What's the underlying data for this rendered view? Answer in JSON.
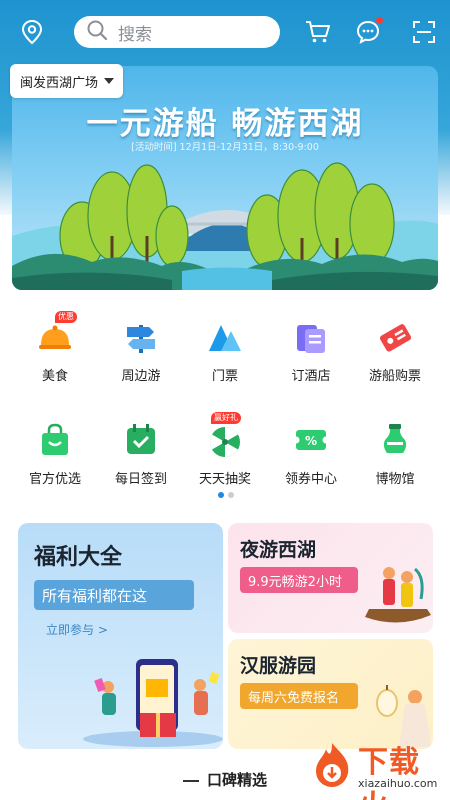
{
  "header": {
    "search_placeholder": "搜索",
    "location": "闽发西湖广场",
    "icons": [
      "location-pin-icon",
      "search-icon",
      "cart-icon",
      "message-icon",
      "scan-icon"
    ]
  },
  "banner": {
    "title": "一元游船  畅游西湖",
    "subtitle": "[活动时间] 12月1日-12月31日，8:30-9:00"
  },
  "grid": {
    "row1": [
      {
        "label": "美食",
        "icon": "food-cloche-icon",
        "tag": "优惠"
      },
      {
        "label": "周边游",
        "icon": "signpost-icon",
        "tag": ""
      },
      {
        "label": "门票",
        "icon": "mountain-icon",
        "tag": ""
      },
      {
        "label": "订酒店",
        "icon": "hotel-cards-icon",
        "tag": ""
      },
      {
        "label": "游船购票",
        "icon": "ticket-icon",
        "tag": ""
      }
    ],
    "row2": [
      {
        "label": "官方优选",
        "icon": "shopping-bag-icon",
        "tag": ""
      },
      {
        "label": "每日签到",
        "icon": "calendar-check-icon",
        "tag": ""
      },
      {
        "label": "天天抽奖",
        "icon": "lottery-wheel-icon",
        "tag": "赢好礼"
      },
      {
        "label": "领券中心",
        "icon": "coupon-icon",
        "tag": ""
      },
      {
        "label": "博物馆",
        "icon": "vase-icon",
        "tag": ""
      }
    ],
    "pager": {
      "active": 1,
      "total": 2
    }
  },
  "cards": {
    "welfare": {
      "title": "福利大全",
      "pill": "所有福利都在这",
      "link": "立即参与 >"
    },
    "night": {
      "title": "夜游西湖",
      "pill": "9.9元畅游2小时"
    },
    "hanfu": {
      "title": "汉服游园",
      "pill": "每周六免费报名"
    }
  },
  "section": {
    "title": "口碑精选"
  },
  "watermark": {
    "text": "下载火",
    "sub": "xiazaihuo.com"
  },
  "colors": {
    "accent": "#1e93cf",
    "tag_red": "#ff3b30",
    "pager_active": "#1e88e5"
  }
}
